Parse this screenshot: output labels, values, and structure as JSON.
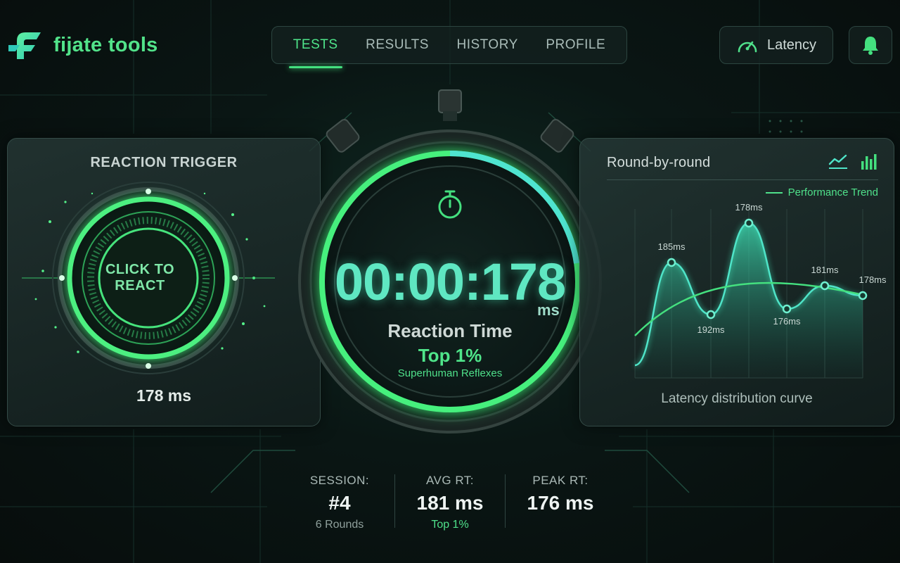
{
  "app": {
    "name": "fijate tools"
  },
  "nav": {
    "tabs": [
      {
        "label": "TESTS",
        "active": true
      },
      {
        "label": "RESULTS"
      },
      {
        "label": "HISTORY"
      },
      {
        "label": "PROFILE"
      }
    ]
  },
  "header": {
    "latency_label": "Latency",
    "latency_icon": "gauge-icon",
    "bell_icon": "bell-icon"
  },
  "trigger": {
    "title": "REACTION TRIGGER",
    "button_line1": "CLICK TO",
    "button_line2": "REACT",
    "value": "178 ms"
  },
  "timer": {
    "readout": "00:00:178",
    "unit": "ms",
    "label": "Reaction Time",
    "rank": "Top 1%",
    "subtitle": "Superhuman Reflexes"
  },
  "rounds": {
    "title": "Round-by-round",
    "legend": "Performance Trend",
    "caption": "Latency distribution curve",
    "view_icons": [
      "line-chart-icon",
      "bar-chart-icon"
    ]
  },
  "chart_data": {
    "type": "line",
    "title": "Round-by-round",
    "series": [
      {
        "name": "Performance Trend",
        "values": [
          185,
          192,
          178,
          176,
          181,
          178
        ]
      }
    ],
    "point_labels": [
      "185ms",
      "192ms",
      "178ms",
      "176ms",
      "181ms",
      "178ms"
    ],
    "caption": "Latency distribution curve",
    "grid": true,
    "legend_position": "top-right"
  },
  "stats": [
    {
      "label": "SESSION:",
      "value": "#4",
      "sub": "6 Rounds"
    },
    {
      "label": "AVG RT:",
      "value": "181 ms",
      "sub": "Top 1%"
    },
    {
      "label": "PEAK RT:",
      "value": "176 ms",
      "sub": ""
    }
  ],
  "colors": {
    "accent": "#44e07f",
    "cyan": "#5fe7c2",
    "panel_border": "#344b47"
  }
}
